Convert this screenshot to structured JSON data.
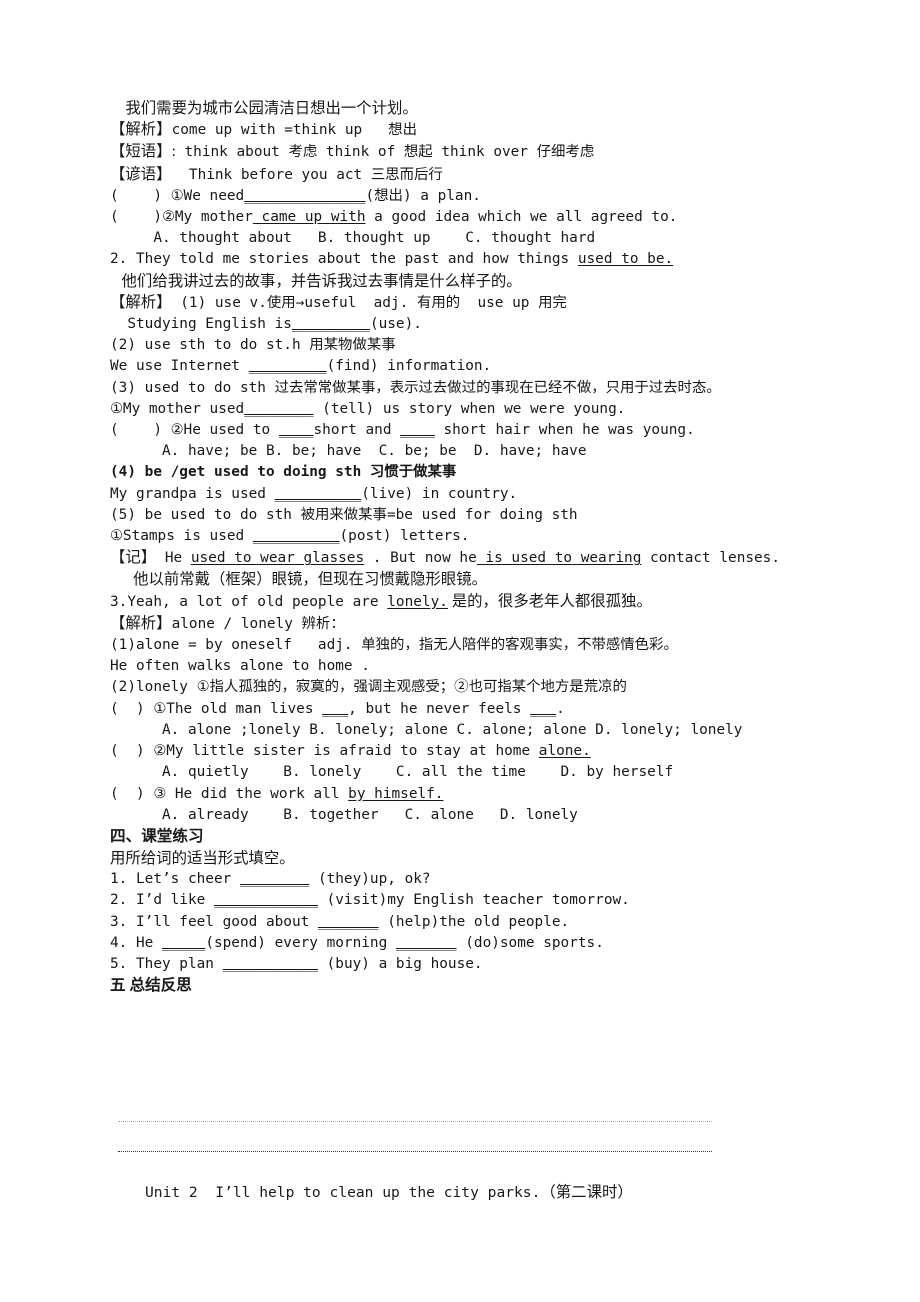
{
  "document": {
    "type": "worksheet-page",
    "language": "zh-CN + en",
    "background_color": "#ffffff",
    "text_color": "#181818"
  },
  "body_lines": {
    "l01": "    我们需要为城市公园清洁日想出一个计划。",
    "l02_label": "【解析】",
    "l02_rest": "come up with =think up   想出",
    "l03_label": "【短语】:",
    "l03_rest": " think about 考虑 think of 想起 think over 仔细考虑",
    "l04_label": "【谚语】",
    "l04_rest": "  Think before you act 三思而后行",
    "l05_a": "(    ) ①We need",
    "l05_blank": "______________",
    "l05_b": "(想出) a plan.",
    "l06_a": "(    )②My mother",
    "l06_ul": " came up with",
    "l06_b": " a good idea which we all agreed to.",
    "l07": "     A. thought about   B. thought up    C. thought hard",
    "l08_a": "2. They told me stories about the past and how things ",
    "l08_ul": "used to be.",
    "l09": "   他们给我讲过去的故事，并告诉我过去事情是什么样子的。",
    "l10_label": "【解析】",
    "l10_rest": " (1) use v.使用→useful  adj. 有用的  use up 用完",
    "l11_a": "  Studying English is",
    "l11_blank": "_________",
    "l11_b": "(use).",
    "l12": "(2) use sth to do st.h 用某物做某事",
    "l13_a": "We use Internet ",
    "l13_blank": "_________",
    "l13_b": "(find) information.",
    "l14": "(3) used to do sth 过去常常做某事，表示过去做过的事现在已经不做，只用于过去时态。",
    "l15_a": "①My mother used",
    "l15_blank": "________",
    "l15_b": " (tell) us story when we were young.",
    "l16_a": "(    ) ②He used to ",
    "l16_blank1": "____",
    "l16_b": "short and ",
    "l16_blank2": "____",
    "l16_c": " short hair when he was young.",
    "l17": "      A. have; be B. be; have  C. be; be  D. have; have",
    "l18": "(4) be /get used to doing sth 习惯于做某事",
    "l19_a": "My grandpa is used ",
    "l19_blank": "__________",
    "l19_b": "(live) in country.",
    "l20": "(5) be used to do sth 被用来做某事=be used for doing sth",
    "l21_a": "①Stamps is used ",
    "l21_blank": "__________",
    "l21_b": "(post) letters.",
    "l22_label": "【记】",
    "l22_a": " He ",
    "l22_ul1": "used to wear glasses",
    "l22_b": " . But now he",
    "l22_ul2": " is used to wearing",
    "l22_c": " contact lenses.",
    "l23": "      他以前常戴（框架）眼镜，但现在习惯戴隐形眼镜。",
    "l24_a": "3.Yeah, a lot of old people are ",
    "l24_ul": "lonely.",
    "l24_b": " 是的，很多老年人都很孤独。",
    "l25_label": "【解析】",
    "l25_rest": "alone / lonely 辨析：",
    "l26": "(1)alone = by oneself   adj. 单独的，指无人陪伴的客观事实，不带感情色彩。",
    "l27": "He often walks alone to home .",
    "l28": "(2)lonely ①指人孤独的，寂寞的，强调主观感受；②也可指某个地方是荒凉的",
    "l29_a": "(  ) ①The old man lives ",
    "l29_blank1": "___",
    "l29_b": ", but he never feels ",
    "l29_blank2": "___",
    "l29_c": ".",
    "l30": "      A. alone ;lonely B. lonely; alone C. alone; alone D. lonely; lonely",
    "l31_a": "(  ) ②My little sister is afraid to stay at home ",
    "l31_ul": "alone.",
    "l32": "      A. quietly    B. lonely    C. all the time    D. by herself",
    "l33_a": "(  ) ③ He did the work all ",
    "l33_ul": "by himself.",
    "l34": "      A. already    B. together   C. alone   D. lonely",
    "l35_heading": "四、课堂练习",
    "l36": "用所给词的适当形式填空。",
    "l37_a": "1. Let’s cheer ",
    "l37_blank": "________",
    "l37_b": " (they)up, ok?",
    "l38_a": "2. I’d like ",
    "l38_blank": "____________",
    "l38_b": " (visit)my English teacher tomorrow.",
    "l39_a": "3. I’ll feel good about ",
    "l39_blank": "_______",
    "l39_b": " (help)the old people.",
    "l40_a": "4. He ",
    "l40_blank1": "_____",
    "l40_b": "(spend) every morning ",
    "l40_blank2": "_______",
    "l40_c": " (do)some sports.",
    "l41_a": "5. They plan ",
    "l41_blank": "___________",
    "l41_b": " (buy) a big house.",
    "l42_heading": "五 总结反思"
  },
  "footer": {
    "title_en": "Unit 2  I’ll help to clean up the city parks.",
    "title_cn": "（第二课时）"
  },
  "rules": {
    "count": 2,
    "first_color": "#b9a6ad",
    "second_color": "#3a3a3a"
  }
}
